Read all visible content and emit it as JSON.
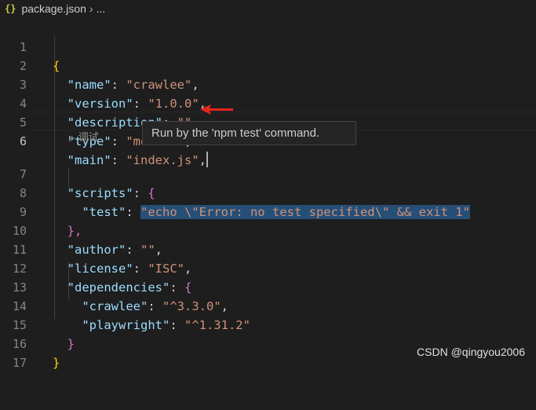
{
  "breadcrumb": {
    "icon": "json-braces-icon",
    "icon_glyph": "{}",
    "file": "package.json",
    "separator": "›",
    "more": "..."
  },
  "editor": {
    "active_line": 6,
    "lines": [
      {
        "n": "1"
      },
      {
        "n": "2"
      },
      {
        "n": "3"
      },
      {
        "n": "4"
      },
      {
        "n": "5"
      },
      {
        "n": "6"
      },
      {
        "n": "7"
      },
      {
        "n": "8"
      },
      {
        "n": "9"
      },
      {
        "n": "10"
      },
      {
        "n": "11"
      },
      {
        "n": "12"
      },
      {
        "n": "13"
      },
      {
        "n": "14"
      },
      {
        "n": "15"
      },
      {
        "n": "16"
      },
      {
        "n": "17"
      }
    ],
    "tokens": {
      "open_brace": "{",
      "close_brace": "}",
      "name_key": "\"name\"",
      "name_val": "\"crawlee\"",
      "version_key": "\"version\"",
      "version_val": "\"1.0.0\"",
      "description_key": "\"description\"",
      "description_val": "\"\"",
      "type_key": "\"type\"",
      "type_val": "\"module\"",
      "main_key": "\"main\"",
      "main_val": "\"index.js\"",
      "scripts_key": "\"scripts\"",
      "scripts_open": "{",
      "test_key": "\"test\"",
      "test_val": "\"echo \\\"Error: no test specified\\\" && exit 1\"",
      "scripts_close": "},",
      "author_key": "\"author\"",
      "author_val": "\"\"",
      "license_key": "\"license\"",
      "license_val": "\"ISC\"",
      "deps_key": "\"dependencies\"",
      "deps_open": "{",
      "crawlee_key": "\"crawlee\"",
      "crawlee_val": "\"^3.3.0\"",
      "playwright_key": "\"playwright\"",
      "playwright_val": "\"^1.31.2\"",
      "deps_close": "}"
    }
  },
  "codelens": {
    "label": "调试"
  },
  "tooltip": {
    "text": "Run by the 'npm test' command."
  },
  "annotation": {
    "arrow_color": "#e8241c"
  },
  "watermark": {
    "text": "CSDN @qingyou2006"
  },
  "colors": {
    "background": "#1e1e1e",
    "key": "#9cdcfe",
    "string": "#ce9178",
    "bracket_level1": "#ffd700",
    "bracket_level2": "#da70d6",
    "bracket_level3": "#179fff",
    "selection": "#264f78"
  }
}
